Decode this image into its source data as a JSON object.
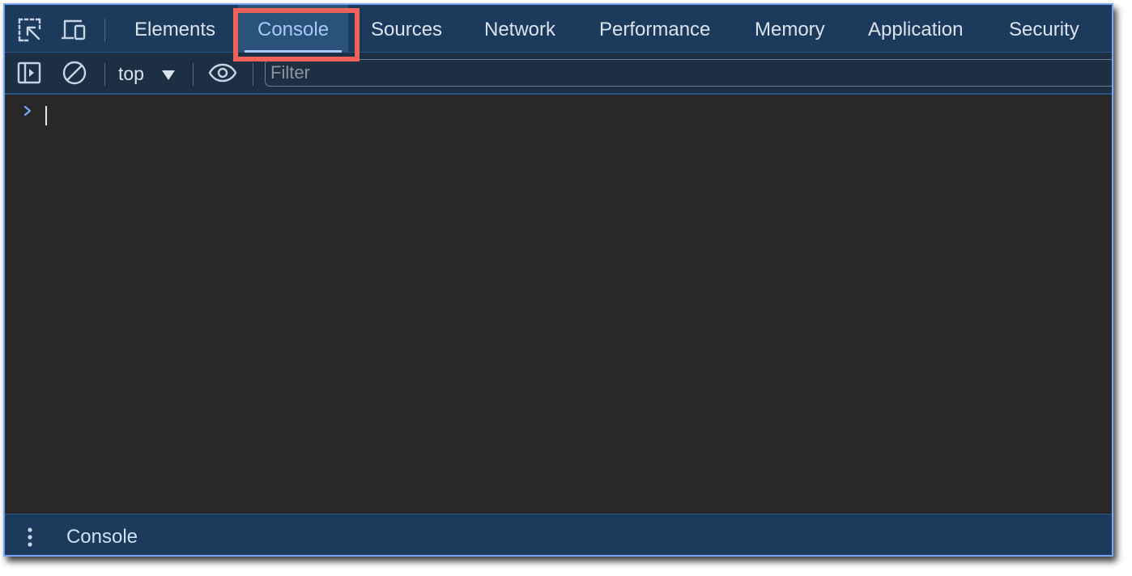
{
  "tabbar": {
    "icons": [
      "inspect-element-icon",
      "device-toolbar-icon"
    ],
    "tabs": [
      {
        "label": "Elements"
      },
      {
        "label": "Console",
        "active": true
      },
      {
        "label": "Sources"
      },
      {
        "label": "Network"
      },
      {
        "label": "Performance"
      },
      {
        "label": "Memory"
      },
      {
        "label": "Application"
      },
      {
        "label": "Security"
      }
    ]
  },
  "toolbar": {
    "context": "top",
    "filter_placeholder": "Filter",
    "filter_value": ""
  },
  "drawer": {
    "tab_label": "Console"
  },
  "colors": {
    "accent": "#7aa7f5",
    "highlight": "#f0625a",
    "tabbar_bg": "#1b3a5c",
    "console_bg": "#282828"
  }
}
